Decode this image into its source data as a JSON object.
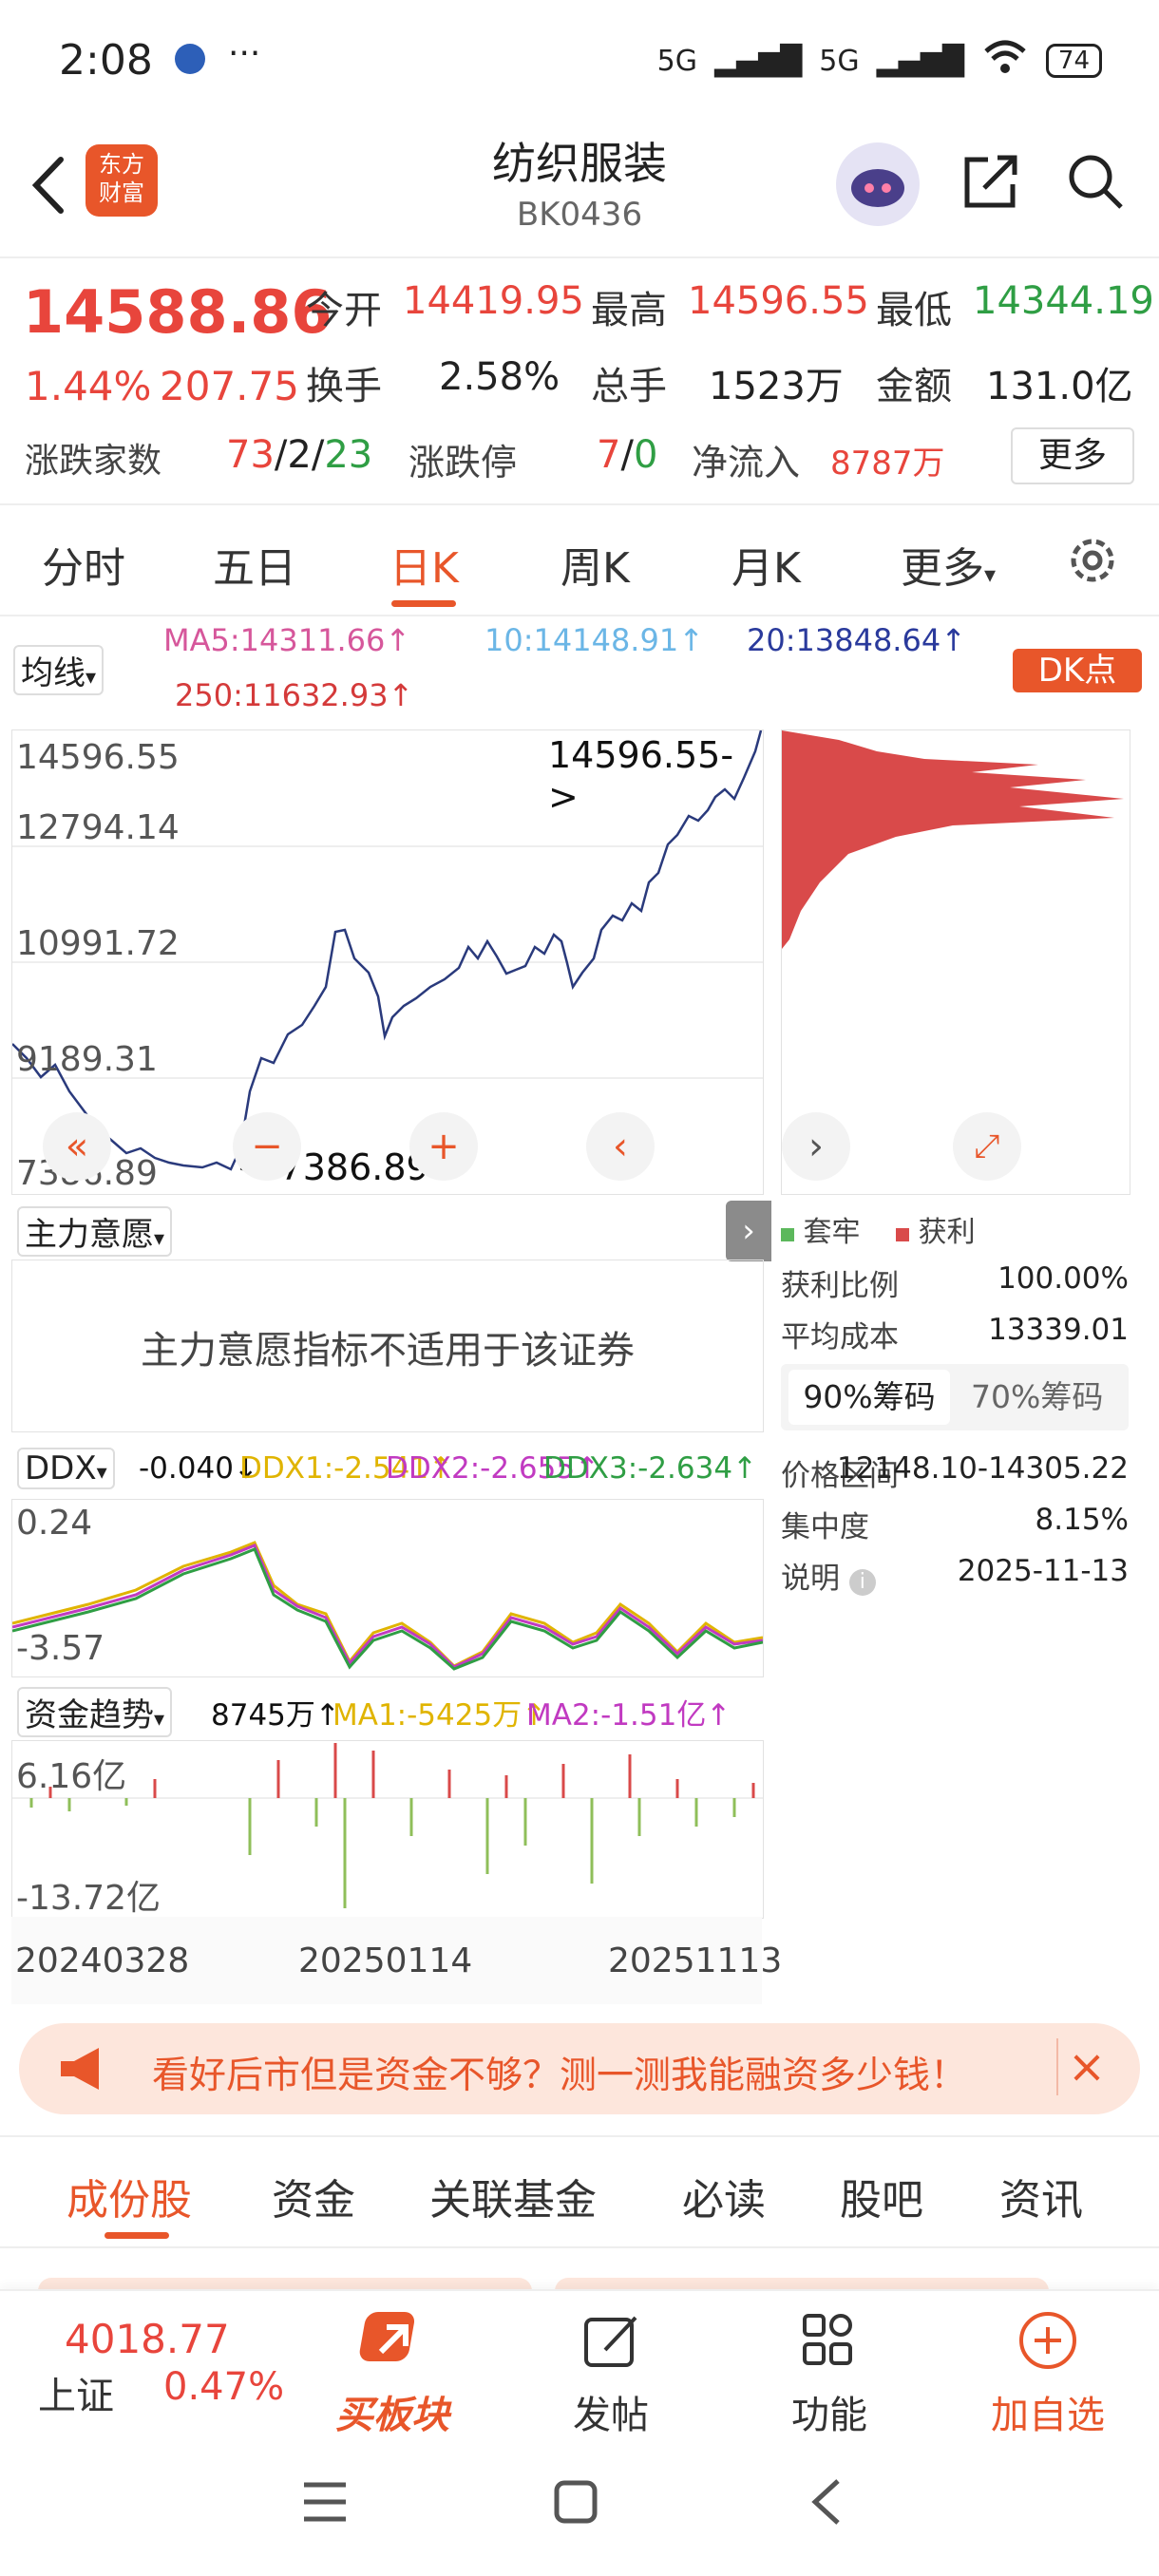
{
  "status": {
    "time": "2:08",
    "network1": "5G",
    "network2": "5G",
    "battery": "74"
  },
  "header": {
    "title": "纺织服装",
    "code": "BK0436",
    "logo_text1": "东方",
    "logo_text2": "财富"
  },
  "quote": {
    "price": "14588.86",
    "pct": "1.44%",
    "change": "207.75",
    "open_label": "今开",
    "open": "14419.95",
    "high_label": "最高",
    "high": "14596.55",
    "low_label": "最低",
    "low": "14344.19",
    "turnover_label": "换手",
    "turnover": "2.58%",
    "volume_label": "总手",
    "volume": "1523万",
    "amount_label": "金额",
    "amount": "131.0亿",
    "breadth_label": "涨跌家数",
    "up": "73",
    "flat": "2",
    "down": "23",
    "limit_label": "涨跌停",
    "limit_up": "7",
    "limit_down": "0",
    "inflow_label": "净流入",
    "inflow": "8787万",
    "more": "更多"
  },
  "period_tabs": [
    "分时",
    "五日",
    "日K",
    "周K",
    "月K",
    "更多"
  ],
  "ma": {
    "selector": "均线",
    "ma5": "MA5:14311.66↑",
    "ma10": "10:14148.91↑",
    "ma20": "20:13848.64↑",
    "ma250": "250:11632.93↑",
    "dk": "DK点"
  },
  "kline": {
    "y_labels": [
      "14596.55",
      "12794.14",
      "10991.72",
      "9189.31",
      "7386.89"
    ],
    "max_marker": "14596.55->",
    "min_marker": "<-7386.89"
  },
  "intent": {
    "selector": "主力意愿",
    "message": "主力意愿指标不适用于该证券"
  },
  "chip": {
    "legend_trapped": "套牢",
    "legend_profit": "获利",
    "profit_ratio_label": "获利比例",
    "profit_ratio": "100.00%",
    "avg_cost_label": "平均成本",
    "avg_cost": "13339.01",
    "tab90": "90%筹码",
    "tab70": "70%筹码",
    "range_label": "价格区间",
    "range": "12148.10-14305.22",
    "concentration_label": "集中度",
    "concentration": "8.15%",
    "note_label": "说明",
    "date": "2025-11-13"
  },
  "ddx": {
    "selector": "DDX",
    "value": "-0.040↓",
    "ddx1": "DDX1:-2.541↑",
    "ddx2": "DDX2:-2.655↑",
    "ddx3": "DDX3:-2.634↑",
    "y_top": "0.24",
    "y_bottom": "-3.57"
  },
  "fund": {
    "selector": "资金趋势",
    "value": "8745万↑",
    "ma1": "MA1:-5425万↑",
    "ma2": "MA2:-1.51亿↑",
    "y_top": "6.16亿",
    "y_bottom": "-13.72亿"
  },
  "x_axis": [
    "20240328",
    "20250114",
    "20251113"
  ],
  "banner": {
    "text": "看好后市但是资金不够？测一测我能融资多少钱！"
  },
  "section_tabs": [
    "成份股",
    "资金",
    "关联基金",
    "必读",
    "股吧",
    "资讯"
  ],
  "bottom": {
    "index_value": "4018.77",
    "index_name": "上证",
    "index_pct": "0.47%",
    "buy_sector": "买板块",
    "post": "发帖",
    "functions": "功能",
    "add_watch": "加自选"
  },
  "colors": {
    "accent": "#e8562a",
    "up": "#e8453c",
    "down": "#2f9e44",
    "line": "#2a3a7c"
  }
}
